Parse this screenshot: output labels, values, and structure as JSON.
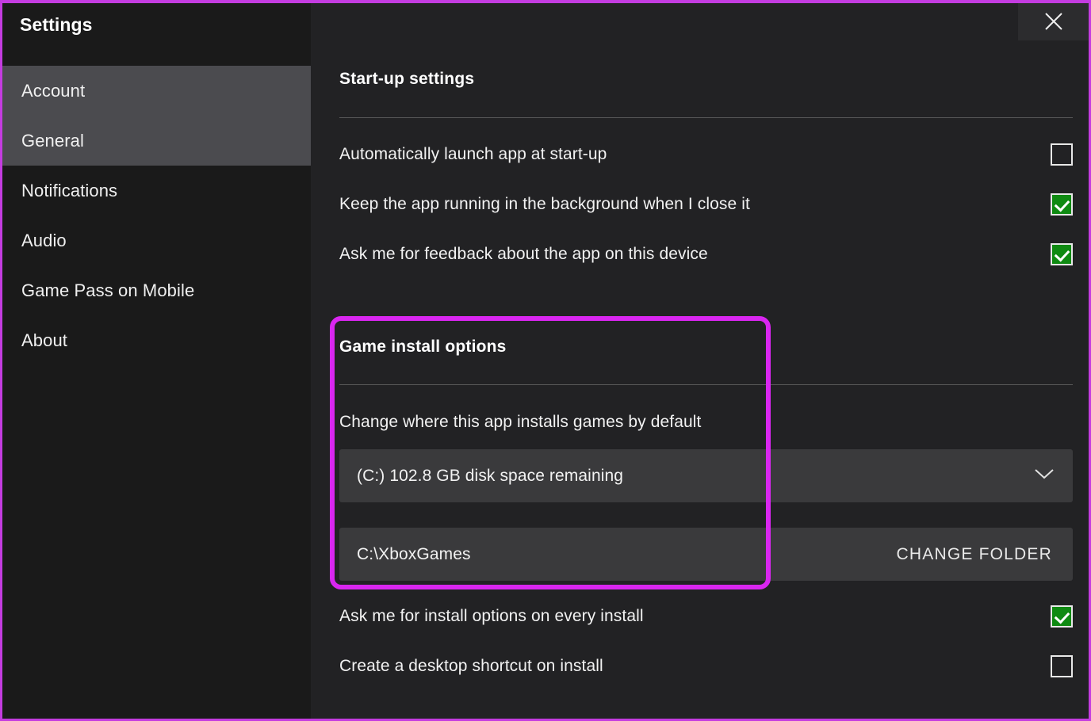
{
  "window": {
    "accent_color": "#d926f0",
    "close_icon": "close-icon"
  },
  "sidebar": {
    "title": "Settings",
    "items": [
      {
        "label": "Account",
        "highlighted": true
      },
      {
        "label": "General",
        "highlighted": true
      },
      {
        "label": "Notifications",
        "highlighted": false
      },
      {
        "label": "Audio",
        "highlighted": false
      },
      {
        "label": "Game Pass on Mobile",
        "highlighted": false
      },
      {
        "label": "About",
        "highlighted": false
      }
    ]
  },
  "main": {
    "startup": {
      "title": "Start-up settings",
      "options": [
        {
          "label": "Automatically launch app at start-up",
          "checked": false
        },
        {
          "label": "Keep the app running in the background when I close it",
          "checked": true
        },
        {
          "label": "Ask me for feedback about the app on this device",
          "checked": true
        }
      ]
    },
    "install": {
      "title": "Game install options",
      "description": "Change where this app installs games by default",
      "drive_value": "(C:) 102.8 GB disk space remaining",
      "drive_chevron_icon": "chevron-down-icon",
      "path_value": "C:\\XboxGames",
      "change_folder_label": "CHANGE FOLDER",
      "options": [
        {
          "label": "Ask me for install options on every install",
          "checked": true
        },
        {
          "label": "Create a desktop shortcut on install",
          "checked": false
        }
      ]
    }
  }
}
